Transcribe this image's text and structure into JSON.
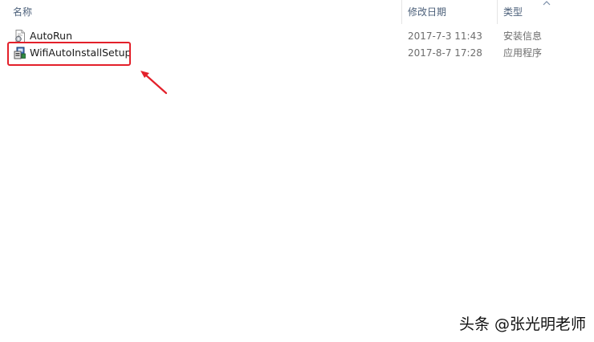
{
  "columns": {
    "name": "名称",
    "date": "修改日期",
    "type": "类型"
  },
  "files": [
    {
      "name": "AutoRun",
      "date": "2017-7-3 11:43",
      "type": "安装信息",
      "icon": "setup-info-file-icon"
    },
    {
      "name": "WifiAutoInstallSetup",
      "date": "2017-8-7 17:28",
      "type": "应用程序",
      "icon": "installer-exe-icon"
    }
  ],
  "sort": {
    "column": "name",
    "icon": "sort-up-icon"
  },
  "annotation": {
    "color": "#e3202a",
    "target": "WifiAutoInstallSetup"
  },
  "watermark": {
    "text": "头条 @张光明老师"
  },
  "colors": {
    "header_text": "#4c607a",
    "detail_text": "#6d6d6d",
    "annotation": "#e3202a"
  }
}
